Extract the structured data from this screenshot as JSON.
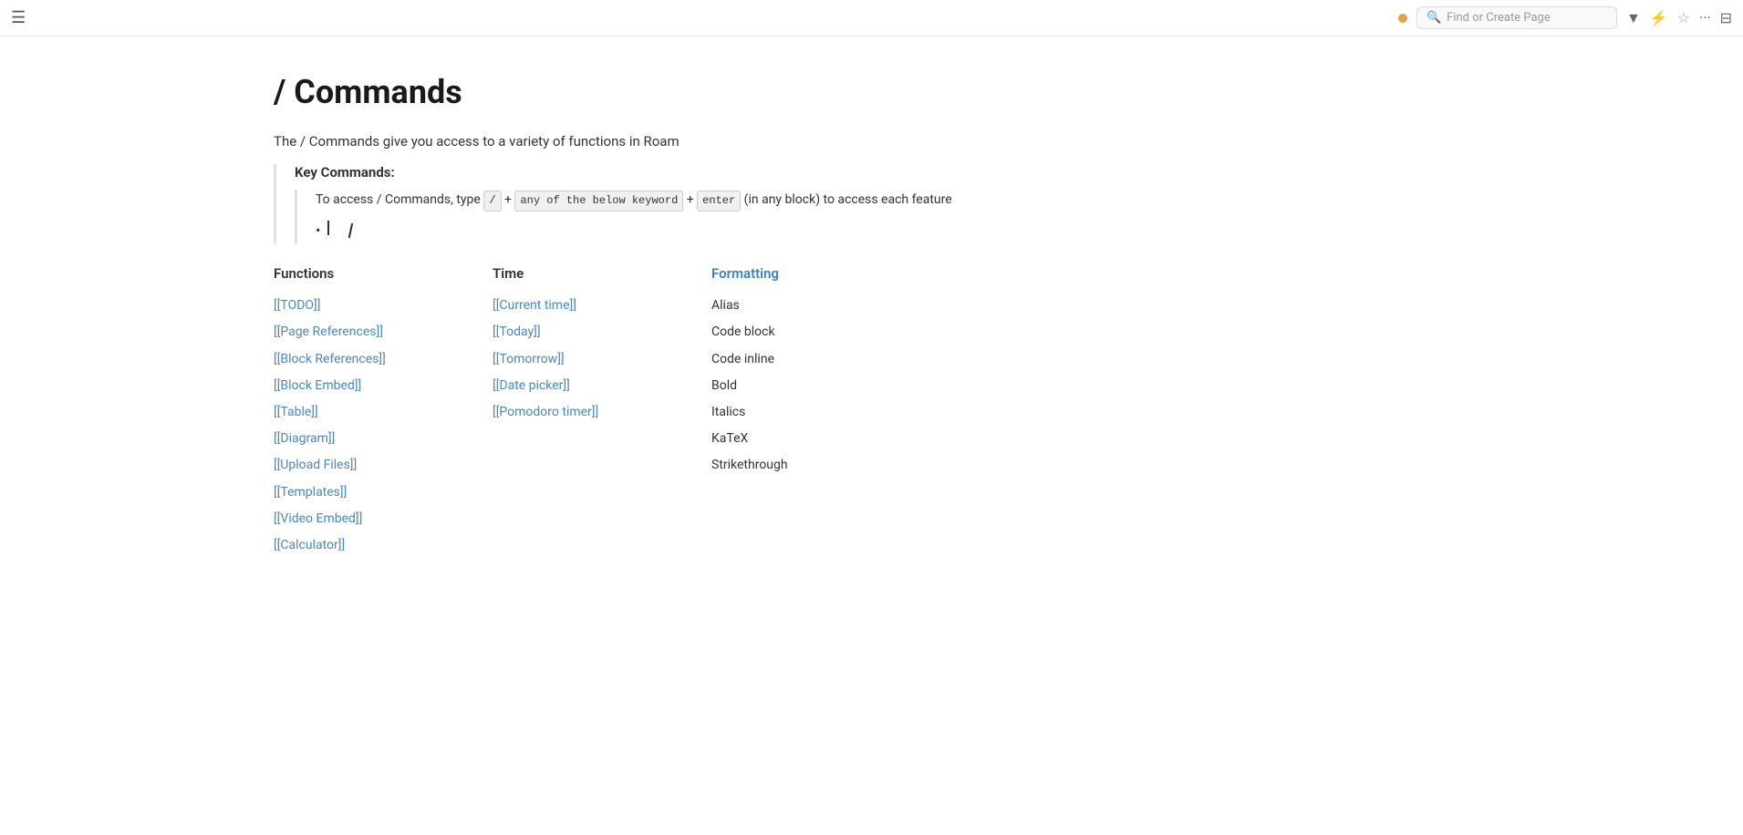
{
  "topbar": {
    "hamburger": "☰",
    "search_placeholder": "Find or Create Page",
    "status_dot_color": "#e8a040",
    "icons": {
      "filter": "▼",
      "filter2": "⚡",
      "star": "☆",
      "more": "···",
      "layout": "⊟"
    }
  },
  "page": {
    "title": "/ Commands",
    "intro": "The / Commands give you access to a variety of functions in Roam"
  },
  "key_commands": {
    "label": "Key Commands:",
    "instruction_prefix": "To access / Commands, type",
    "code1": "/",
    "plus1": "+",
    "code2": "any of the below keyword",
    "plus2": "+",
    "code3": "enter",
    "instruction_suffix": "(in any block) to access each feature"
  },
  "columns": {
    "functions": {
      "header": "Functions",
      "items": [
        "[[TODO]]",
        "[[Page References]]",
        "[[Block References]]",
        "[[Block Embed]]",
        "[[Table]]",
        "[[Diagram]]",
        "[[Upload Files]]",
        "[[Templates]]",
        "[[Video Embed]]",
        "[[Calculator]]"
      ]
    },
    "time": {
      "header": "Time",
      "items": [
        "[[Current time]]",
        "[[Today]]",
        "[[Tomorrow]]",
        "[[Date picker]]",
        "[[Pomodoro timer]]"
      ]
    },
    "formatting": {
      "header": "Formatting",
      "items": [
        "Alias",
        "Code block",
        "Code inline",
        "Bold",
        "Italics",
        "KaTeX",
        "Strikethrough"
      ]
    }
  }
}
